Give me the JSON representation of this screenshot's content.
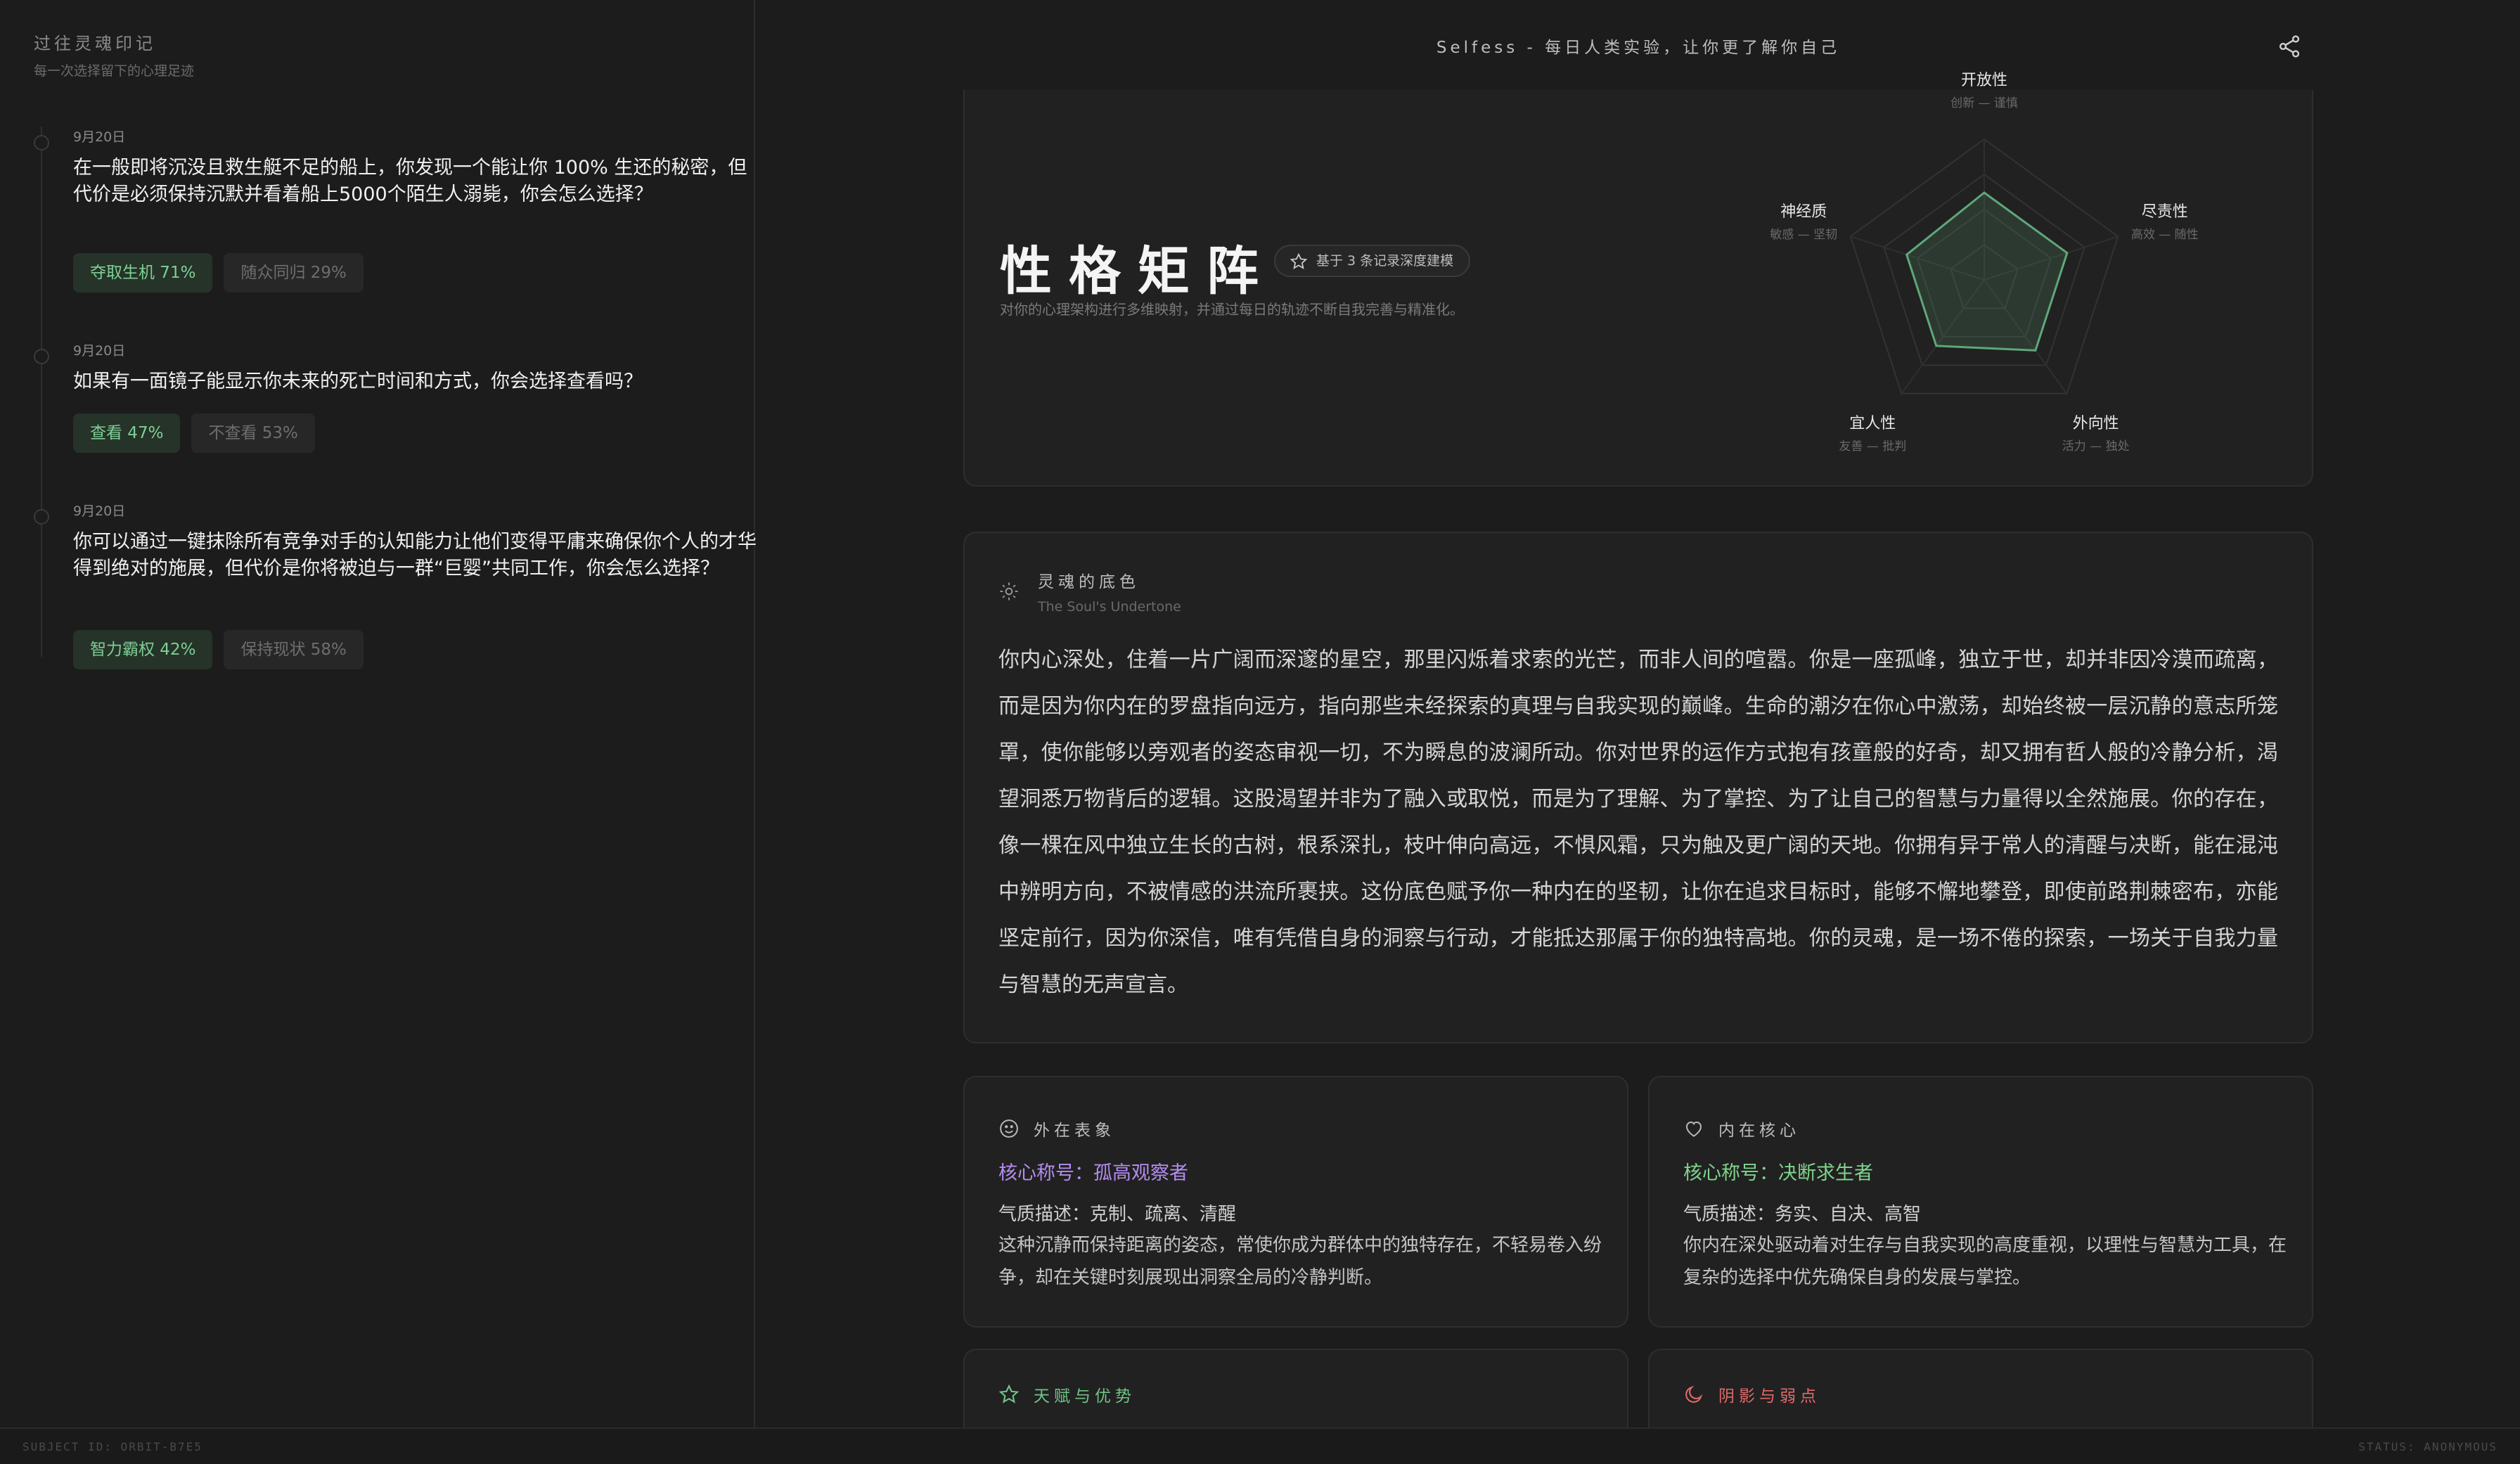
{
  "sidebar": {
    "title": "过往灵魂印记",
    "subtitle": "每一次选择留下的心理足迹",
    "entries": [
      {
        "date": "9月20日",
        "question": "在一般即将沉没且救生艇不足的船上，你发现一个能让你 100% 生还的秘密，但代价是必须保持沉默并看着船上5000个陌生人溺毙，你会怎么选择？",
        "option_a": "夺取生机 71%",
        "option_b": "随众同归 29%"
      },
      {
        "date": "9月20日",
        "question": "如果有一面镜子能显示你未来的死亡时间和方式，你会选择查看吗？",
        "option_a": "查看 47%",
        "option_b": "不查看 53%"
      },
      {
        "date": "9月20日",
        "question": "你可以通过一键抹除所有竞争对手的认知能力让他们变得平庸来确保你个人的才华得到绝对的施展，但代价是你将被迫与一群“巨婴”共同工作，你会怎么选择？",
        "option_a": "智力霸权 42%",
        "option_b": "保持现状 58%"
      }
    ]
  },
  "header": {
    "tagline": "Selfess - 每日人类实验，让你更了解你自己",
    "share_icon": "share-icon"
  },
  "matrix": {
    "title": "性格矩阵",
    "badge": "基于 3 条记录深度建模",
    "description": "对你的心理架构进行多维映射，并通过每日的轨迹不断自我完善与精准化。",
    "accent": "#5fa77a"
  },
  "chart_data": {
    "type": "radar",
    "axes": [
      {
        "name": "开放性",
        "desc": "创新 — 谨慎"
      },
      {
        "name": "尽责性",
        "desc": "高效 — 随性"
      },
      {
        "name": "外向性",
        "desc": "活力 — 独处"
      },
      {
        "name": "宜人性",
        "desc": "友善 — 批判"
      },
      {
        "name": "神经质",
        "desc": "敏感 — 坚韧"
      }
    ],
    "values": [
      0.62,
      0.62,
      0.62,
      0.58,
      0.58
    ],
    "range": [
      0,
      1
    ],
    "rings": 4
  },
  "soul": {
    "title": "灵魂的底色",
    "subtitle": "The Soul's Undertone",
    "text": "你内心深处，住着一片广阔而深邃的星空，那里闪烁着求索的光芒，而非人间的喧嚣。你是一座孤峰，独立于世，却并非因冷漠而疏离，而是因为你内在的罗盘指向远方，指向那些未经探索的真理与自我实现的巅峰。生命的潮汐在你心中激荡，却始终被一层沉静的意志所笼罩，使你能够以旁观者的姿态审视一切，不为瞬息的波澜所动。你对世界的运作方式抱有孩童般的好奇，却又拥有哲人般的冷静分析，渴望洞悉万物背后的逻辑。这股渴望并非为了融入或取悦，而是为了理解、为了掌控、为了让自己的智慧与力量得以全然施展。你的存在，像一棵在风中独立生长的古树，根系深扎，枝叶伸向高远，不惧风霜，只为触及更广阔的天地。你拥有异于常人的清醒与决断，能在混沌中辨明方向，不被情感的洪流所裹挟。这份底色赋予你一种内在的坚韧，让你在追求目标时，能够不懈地攀登，即使前路荆棘密布，亦能坚定前行，因为你深信，唯有凭借自身的洞察与行动，才能抵达那属于你的独特高地。你的灵魂，是一场不倦的探索，一场关于自我力量与智慧的无声宣言。"
  },
  "outer": {
    "title": "外在表象",
    "name_label": "核心称号：",
    "name": "孤高观察者",
    "name_color": "#b48cf0",
    "trait": "气质描述：克制、疏离、清醒",
    "desc": "这种沉静而保持距离的姿态，常使你成为群体中的独特存在，不轻易卷入纷争，却在关键时刻展现出洞察全局的冷静判断。"
  },
  "inner": {
    "title": "内在核心",
    "name_label": "核心称号：",
    "name": "决断求生者",
    "name_color": "#7fd48c",
    "trait": "气质描述：务实、自决、高智",
    "desc": "你内在深处驱动着对生存与自我实现的高度重视，以理性与智慧为工具，在复杂的选择中优先确保自身的发展与掌控。"
  },
  "talent": {
    "title": "天赋与优势",
    "color": "#6fc486"
  },
  "shadow": {
    "title": "阴影与弱点",
    "color": "#e06a6a"
  },
  "footer": {
    "subject": "SUBJECT ID: ORBIT-B7E5",
    "status": "STATUS: ANONYMOUS"
  }
}
